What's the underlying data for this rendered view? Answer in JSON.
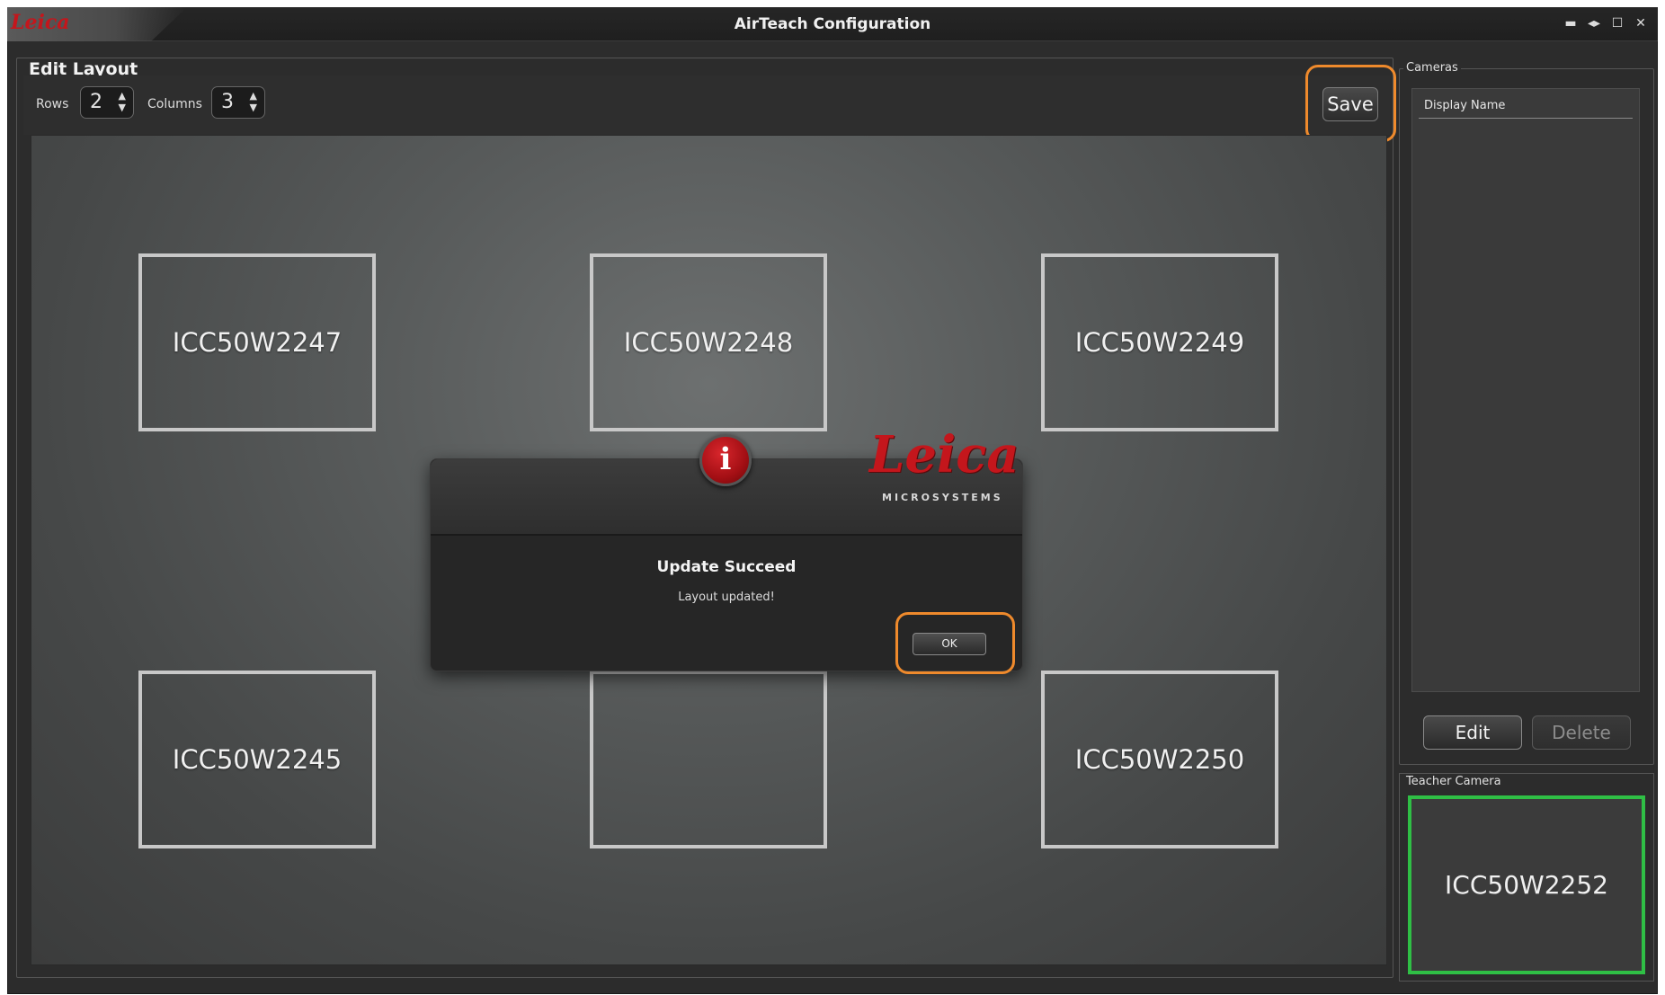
{
  "window": {
    "title": "AirTeach Configuration",
    "logo": "Leica",
    "controls": [
      "▬",
      "◂▸",
      "☐",
      "✕"
    ]
  },
  "edit_layout": {
    "legend": "Edit Layout",
    "rows_label": "Rows",
    "rows_value": "2",
    "columns_label": "Columns",
    "columns_value": "3",
    "save_label": "Save"
  },
  "grid": {
    "cells": [
      "ICC50W2247",
      "ICC50W2248",
      "ICC50W2249",
      "ICC50W2245",
      "",
      "ICC50W2250"
    ]
  },
  "dialog": {
    "logo": "Leica",
    "logo_sub": "MICROSYSTEMS",
    "icon": "i",
    "title": "Update Succeed",
    "message": "Layout updated!",
    "ok_label": "OK"
  },
  "cameras": {
    "legend": "Cameras",
    "column_header": "Display Name",
    "edit_label": "Edit",
    "delete_label": "Delete"
  },
  "teacher": {
    "legend": "Teacher Camera",
    "camera": "ICC50W2252"
  },
  "colors": {
    "highlight": "#ef8a2c",
    "teacher_border": "#2fbf45",
    "leica_red": "#c4161c"
  }
}
